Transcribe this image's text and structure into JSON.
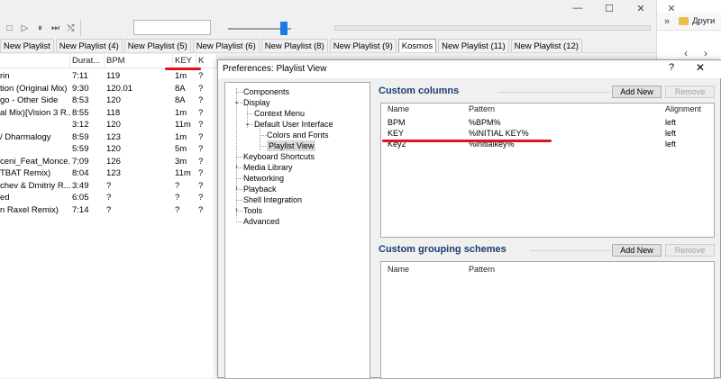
{
  "window": {
    "minimize_glyph": "—",
    "maximize_glyph": "☐",
    "close_glyph": "✕"
  },
  "toolbar": {
    "stop_glyph": "□",
    "play_glyph": "▷",
    "pause_glyph": "⏸",
    "next_glyph": "⏭",
    "random_glyph": "⤭"
  },
  "tabs": [
    "New Playlist",
    "New Playlist (4)",
    "New Playlist (5)",
    "New Playlist (6)",
    "New Playlist (8)",
    "New Playlist (9)",
    "Kosmos",
    "New Playlist (11)",
    "New Playlist (12)"
  ],
  "active_tab_index": 6,
  "playlist": {
    "columns": [
      "Durat...",
      "BPM",
      "KEY",
      "K"
    ],
    "rows": [
      {
        "title": "rin",
        "duration": "7:11",
        "bpm": "119",
        "key": "1m",
        "k": "?"
      },
      {
        "title": "tion (Original Mix)",
        "duration": "9:30",
        "bpm": "120.01",
        "key": "8A",
        "k": "?"
      },
      {
        "title": "go - Other Side",
        "duration": "8:53",
        "bpm": "120",
        "key": "8A",
        "k": "?"
      },
      {
        "title": "al Mix)[Vision 3 R...",
        "duration": "8:55",
        "bpm": "118",
        "key": "1m",
        "k": "?"
      },
      {
        "title": "",
        "duration": "3:12",
        "bpm": "120",
        "key": "11m",
        "k": "?"
      },
      {
        "title": "/ Dharmalogy",
        "duration": "8:59",
        "bpm": "123",
        "key": "1m",
        "k": "?"
      },
      {
        "title": "",
        "duration": "5:59",
        "bpm": "120",
        "key": "5m",
        "k": "?"
      },
      {
        "title": "ceni_Feat_Monce...",
        "duration": "7:09",
        "bpm": "126",
        "key": "3m",
        "k": "?"
      },
      {
        "title": "TBAT Remix)",
        "duration": "8:04",
        "bpm": "123",
        "key": "11m",
        "k": "?"
      },
      {
        "title": "chev & Dmitriy R...",
        "duration": "3:49",
        "bpm": "?",
        "key": "?",
        "k": "?"
      },
      {
        "title": "ed",
        "duration": "6:05",
        "bpm": "?",
        "key": "?",
        "k": "?"
      },
      {
        "title": "n Raxel Remix)",
        "duration": "7:14",
        "bpm": "?",
        "key": "?",
        "k": "?"
      }
    ]
  },
  "browser": {
    "chevron": "»",
    "bookmark_label": "Други",
    "back_glyph": "‹",
    "forward_glyph": "›"
  },
  "dialog": {
    "title": "Preferences: Playlist View",
    "help_glyph": "?",
    "close_glyph": "✕",
    "tree": [
      {
        "label": "Components",
        "level": 0
      },
      {
        "label": "Display",
        "level": 0,
        "expanded": true
      },
      {
        "label": "Context Menu",
        "level": 1
      },
      {
        "label": "Default User Interface",
        "level": 1,
        "expanded": true
      },
      {
        "label": "Colors and Fonts",
        "level": 2
      },
      {
        "label": "Playlist View",
        "level": 2,
        "selected": true
      },
      {
        "label": "Keyboard Shortcuts",
        "level": 0
      },
      {
        "label": "Media Library",
        "level": 0,
        "collapsed": true
      },
      {
        "label": "Networking",
        "level": 0
      },
      {
        "label": "Playback",
        "level": 0,
        "collapsed": true
      },
      {
        "label": "Shell Integration",
        "level": 0
      },
      {
        "label": "Tools",
        "level": 0,
        "collapsed": true
      },
      {
        "label": "Advanced",
        "level": 0
      }
    ],
    "custom_columns": {
      "title": "Custom columns",
      "add_label": "Add New",
      "remove_label": "Remove",
      "headers": [
        "Name",
        "Pattern",
        "Alignment"
      ],
      "rows": [
        {
          "name": "BPM",
          "pattern": "%BPM%",
          "alignment": "left"
        },
        {
          "name": "KEY",
          "pattern": "%INITIAL KEY%",
          "alignment": "left"
        },
        {
          "name": "Key2",
          "pattern": "%initialkey%",
          "alignment": "left"
        }
      ]
    },
    "custom_grouping": {
      "title": "Custom grouping schemes",
      "add_label": "Add New",
      "remove_label": "Remove",
      "headers": [
        "Name",
        "Pattern"
      ]
    }
  },
  "colors": {
    "accent": "#1979e6",
    "annotation_red": "#e0141d",
    "section_title": "#1a3c70"
  }
}
